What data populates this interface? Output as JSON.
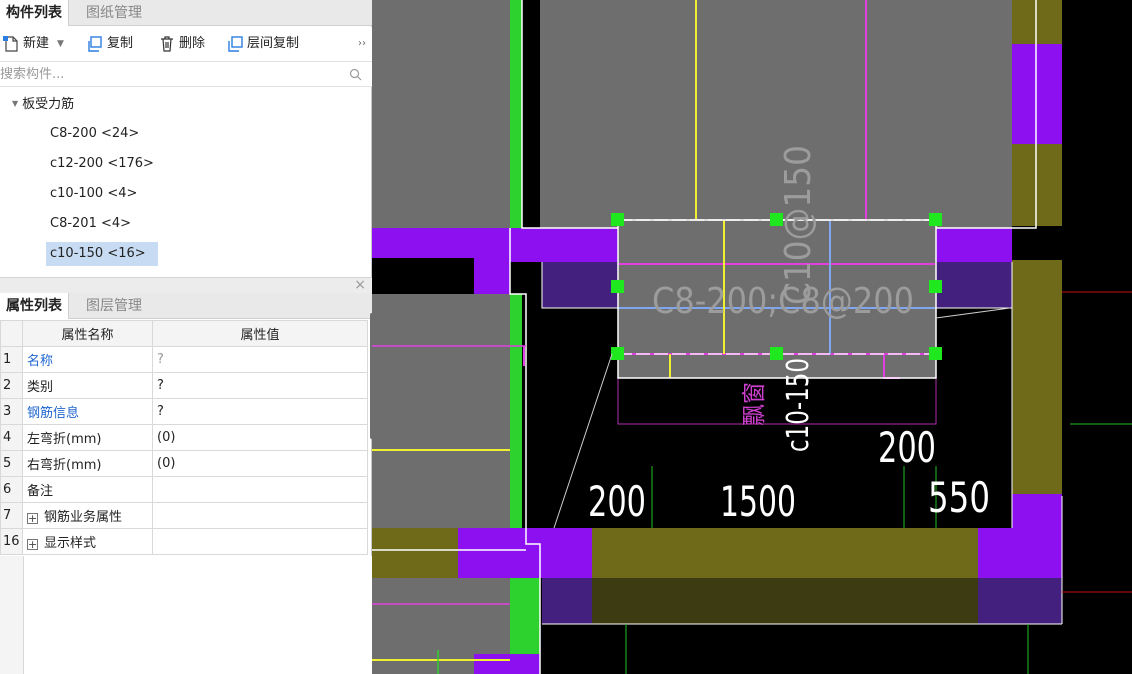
{
  "component_panel": {
    "tabs": [
      {
        "label": "构件列表",
        "active": true
      },
      {
        "label": "图纸管理",
        "active": false
      }
    ],
    "toolbar": {
      "new_label": "新建",
      "copy_label": "复制",
      "delete_label": "删除",
      "floor_copy_label": "层间复制",
      "more_label": "››"
    },
    "search": {
      "placeholder": "搜索构件...",
      "value": ""
    },
    "tree": {
      "group_label": "板受力筋",
      "items": [
        {
          "label": "C8-200 <24>",
          "selected": false
        },
        {
          "label": "c12-200 <176>",
          "selected": false
        },
        {
          "label": "c10-100 <4>",
          "selected": false
        },
        {
          "label": "C8-201 <4>",
          "selected": false
        },
        {
          "label": "c10-150 <16>",
          "selected": true
        }
      ]
    }
  },
  "splitter": {
    "close_label": "×"
  },
  "property_panel": {
    "tabs": [
      {
        "label": "属性列表",
        "active": true
      },
      {
        "label": "图层管理",
        "active": false
      }
    ],
    "columns": [
      "属性名称",
      "属性值"
    ],
    "rows": [
      {
        "index": "1",
        "name": "名称",
        "value": "?",
        "name_color": "blue",
        "value_color": "grey",
        "expandable": false
      },
      {
        "index": "2",
        "name": "类别",
        "value": "?",
        "name_color": "black",
        "value_color": "black",
        "expandable": false
      },
      {
        "index": "3",
        "name": "钢筋信息",
        "value": "?",
        "name_color": "blue",
        "value_color": "black",
        "expandable": false
      },
      {
        "index": "4",
        "name": "左弯折(mm)",
        "value": "(0)",
        "name_color": "black",
        "value_color": "black",
        "expandable": false
      },
      {
        "index": "5",
        "name": "右弯折(mm)",
        "value": "(0)",
        "name_color": "black",
        "value_color": "black",
        "expandable": false
      },
      {
        "index": "6",
        "name": "备注",
        "value": "",
        "name_color": "black",
        "value_color": "black",
        "expandable": false
      },
      {
        "index": "7",
        "name": "钢筋业务属性",
        "value": "",
        "name_color": "black",
        "value_color": "black",
        "expandable": true
      },
      {
        "index": "16",
        "name": "显示样式",
        "value": "",
        "name_color": "black",
        "value_color": "black",
        "expandable": true
      }
    ]
  },
  "canvas": {
    "labels": {
      "rebar_horizontal": "C8-200;C8@200",
      "rebar_vertical_grey": "C10@150",
      "rebar_vertical_white": "c10-150",
      "window_label": "飘窗",
      "dim_200_left": "200",
      "dim_1500": "1500",
      "dim_550": "550",
      "dim_200_right": "200"
    },
    "colors": {
      "background": "#000000",
      "slab": "#6e6e6e",
      "wall_olive": "#6e6a19",
      "column_purple": "#8d10f0",
      "green_line": "#2ed22e",
      "yellow_line": "#f0f032",
      "magenta_line": "#e040e0",
      "blue_line": "#7fa6ee",
      "grip_green": "#1fe81f",
      "dim_green": "#22c022",
      "red_line": "#c01010"
    }
  }
}
